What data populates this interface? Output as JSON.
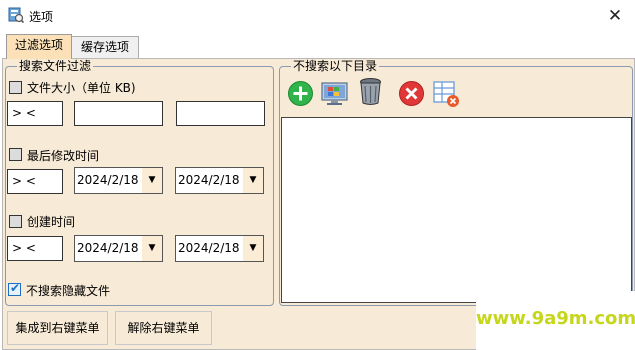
{
  "window": {
    "title": "选项",
    "close_glyph": "✕"
  },
  "tabs": [
    {
      "label": "过滤选项",
      "active": true
    },
    {
      "label": "缓存选项",
      "active": false
    }
  ],
  "search_filter": {
    "legend": "搜索文件过滤",
    "file_size": {
      "label": "文件大小（单位 KB)",
      "checked": false,
      "operator": "> <",
      "min": "",
      "max": ""
    },
    "last_modified": {
      "label": "最后修改时间",
      "checked": false,
      "operator": "> <",
      "from": "2024/2/18",
      "to": "2024/2/18"
    },
    "created": {
      "label": "创建时间",
      "checked": false,
      "operator": "> <",
      "from": "2024/2/18",
      "to": "2024/2/18"
    },
    "hidden_files": {
      "label": "不搜索隐藏文件",
      "checked": true
    }
  },
  "exclude_dirs": {
    "legend": "不搜索以下目录",
    "toolbar": [
      {
        "name": "add-icon"
      },
      {
        "name": "computer-icon"
      },
      {
        "name": "recycle-bin-icon"
      },
      {
        "name": "delete-icon"
      },
      {
        "name": "clear-list-icon"
      }
    ],
    "items": []
  },
  "buttons": {
    "integrate": "集成到右键菜单",
    "remove": "解除右键菜单"
  },
  "watermark": "www.9a9m.com",
  "colors": {
    "panel_bg": "#f7ead6",
    "active_tab": "#fbe0b8",
    "group_border": "#8a9bb0",
    "check_blue": "#1c6fc4",
    "watermark": "#c6d61a"
  }
}
